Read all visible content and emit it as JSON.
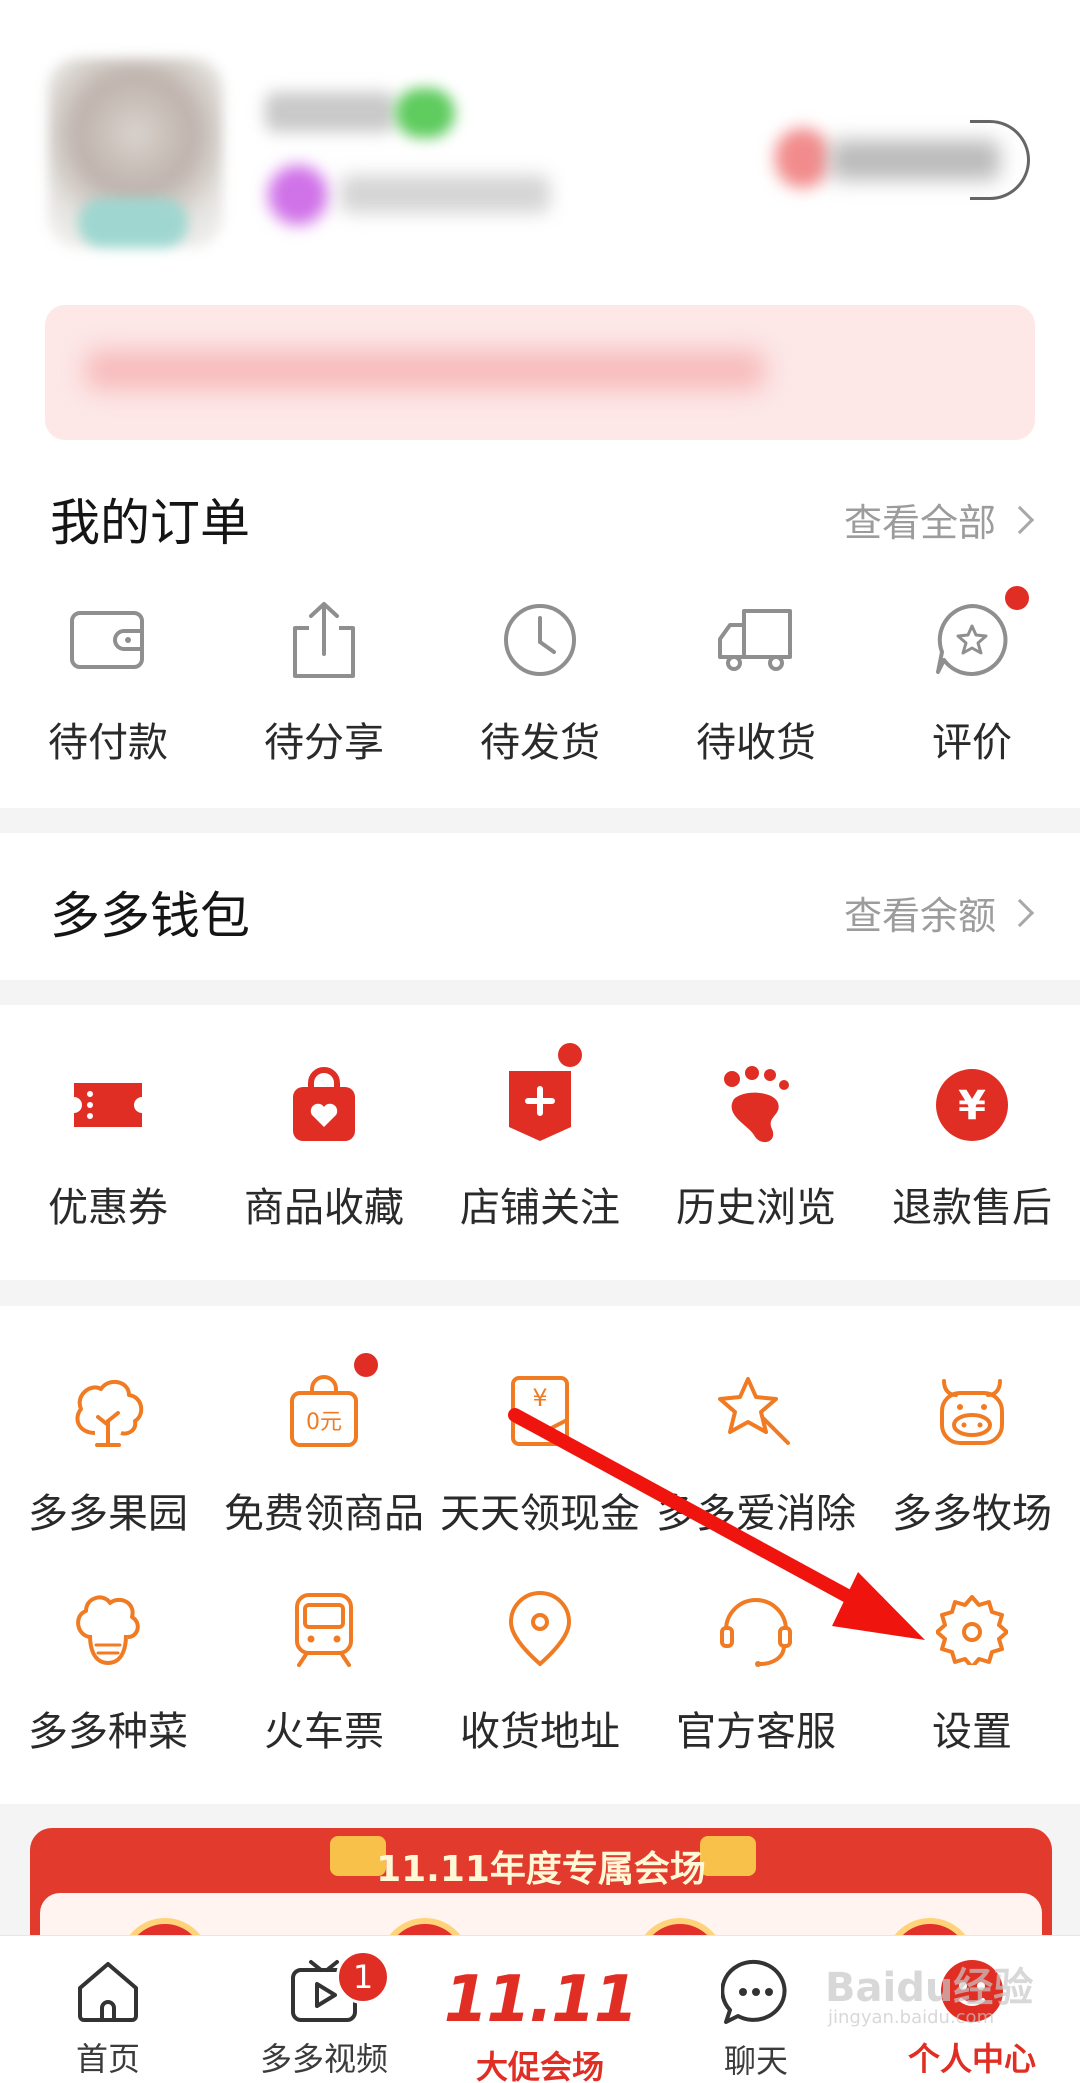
{
  "orders": {
    "title": "我的订单",
    "view_all": "查看全部",
    "items": [
      {
        "label": "待付款",
        "icon": "wallet-icon"
      },
      {
        "label": "待分享",
        "icon": "share-icon"
      },
      {
        "label": "待发货",
        "icon": "clock-icon"
      },
      {
        "label": "待收货",
        "icon": "truck-icon"
      },
      {
        "label": "评价",
        "icon": "review-star-icon"
      }
    ]
  },
  "wallet": {
    "title": "多多钱包",
    "link": "查看余额"
  },
  "tools": {
    "items": [
      {
        "label": "优惠券",
        "icon": "coupon-icon"
      },
      {
        "label": "商品收藏",
        "icon": "favorite-bag-icon"
      },
      {
        "label": "店铺关注",
        "icon": "store-follow-icon"
      },
      {
        "label": "历史浏览",
        "icon": "footprint-icon"
      },
      {
        "label": "退款售后",
        "icon": "refund-yen-icon"
      }
    ]
  },
  "services": {
    "row1": [
      {
        "label": "多多果园",
        "icon": "tree-icon"
      },
      {
        "label": "免费领商品",
        "icon": "free-bag-icon",
        "bag_text": "0元"
      },
      {
        "label": "天天领现金",
        "icon": "cash-envelope-icon",
        "symbol": "¥"
      },
      {
        "label": "多多爱消除",
        "icon": "star-wand-icon"
      },
      {
        "label": "多多牧场",
        "icon": "cow-icon"
      }
    ],
    "row2": [
      {
        "label": "多多种菜",
        "icon": "vegetable-icon"
      },
      {
        "label": "火车票",
        "icon": "train-icon"
      },
      {
        "label": "收货地址",
        "icon": "location-pin-icon"
      },
      {
        "label": "官方客服",
        "icon": "headset-icon"
      },
      {
        "label": "设置",
        "icon": "gear-icon"
      }
    ]
  },
  "promo": {
    "title": "11.11年度专属会场"
  },
  "tabbar": {
    "items": [
      {
        "label": "首页",
        "icon": "home-icon"
      },
      {
        "label": "多多视频",
        "icon": "video-icon",
        "badge": "1"
      },
      {
        "label": "大促会场",
        "logo": "11.11"
      },
      {
        "label": "聊天",
        "icon": "chat-icon"
      },
      {
        "label": "个人中心",
        "icon": "profile-icon"
      }
    ]
  },
  "watermark": {
    "brand": "Baidu经验",
    "sub": "jingyan.baidu.com"
  },
  "colors": {
    "brand_red": "#e02e24",
    "orange": "#f07b22",
    "grey_icon": "#8f8f8f"
  }
}
